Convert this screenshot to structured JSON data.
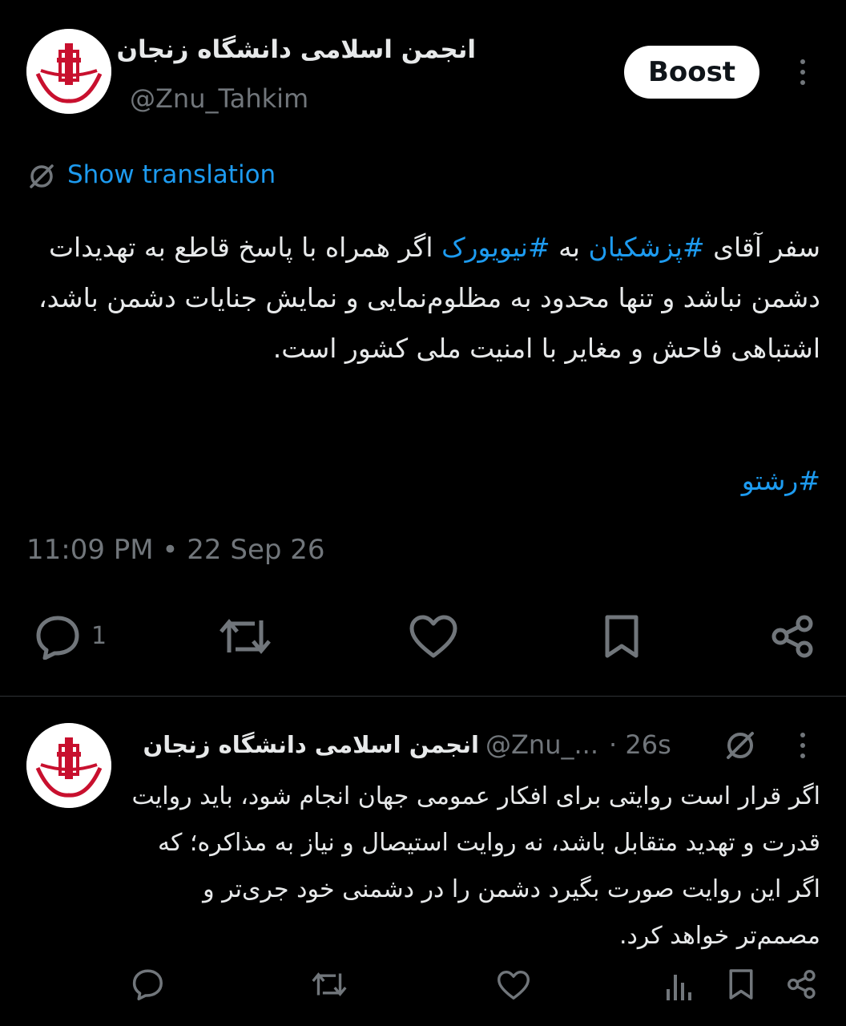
{
  "main_tweet": {
    "author_name": "انجمن اسلامی دانشگاه زنجان",
    "author_handle": "@Znu_Tahkim",
    "avatar_caption": "تحکیم وحدت",
    "boost_label": "Boost",
    "translation_label": "Show translation",
    "text": {
      "p1": "سفر آقای ",
      "tag1": "#پزشکیان",
      "p2": " به ",
      "tag2": "#نیویورک",
      "p3": " اگر همراه با پاسخ قاطع به تهدیدات دشمن نباشد و تنها محدود به مظلوم‌نمایی و نمایش جنایات دشمن باشد، اشتباهی فاحش و مغایر با امنیت ملی کشور است.",
      "tag3": "#رشتو"
    },
    "timestamp": "11:09 PM • 22 Sep 26",
    "reply_count": "1"
  },
  "reply_tweet": {
    "author_name": "انجمن اسلامی دانشگاه زنجان",
    "author_handle": "@Znu_...",
    "time": "· 26s",
    "text": "اگر قرار است روایتی برای افکار عمومی جهان انجام شود، باید روایت قدرت و تهدید متقابل باشد، نه روایت استیصال و نیاز به مذاکره؛ که اگر این روایت صورت بگیرد دشمن را در دشمنی خود جری‌تر و مصمم‌تر خواهد کرد."
  },
  "colors": {
    "background": "#000000",
    "text": "#e7e9ea",
    "muted": "#71767b",
    "link": "#1d9bf0",
    "divider": "#2f3336"
  },
  "icons": [
    "more-icon",
    "translate-icon",
    "reply-icon",
    "retweet-icon",
    "like-icon",
    "bookmark-icon",
    "share-icon",
    "views-icon"
  ]
}
